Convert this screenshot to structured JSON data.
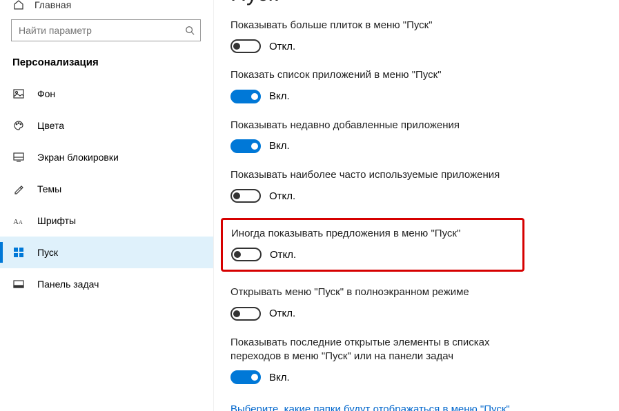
{
  "sidebar": {
    "home": "Главная",
    "search_placeholder": "Найти параметр",
    "section": "Персонализация",
    "items": [
      {
        "label": "Фон"
      },
      {
        "label": "Цвета"
      },
      {
        "label": "Экран блокировки"
      },
      {
        "label": "Темы"
      },
      {
        "label": "Шрифты"
      },
      {
        "label": "Пуск"
      },
      {
        "label": "Панель задач"
      }
    ]
  },
  "main": {
    "title": "Пуск",
    "state_on": "Вкл.",
    "state_off": "Откл.",
    "settings": [
      {
        "label": "Показывать больше плиток в меню \"Пуск\"",
        "on": false
      },
      {
        "label": "Показать список приложений в меню \"Пуск\"",
        "on": true
      },
      {
        "label": "Показывать недавно добавленные приложения",
        "on": true
      },
      {
        "label": "Показывать наиболее часто используемые приложения",
        "on": false
      },
      {
        "label": "Иногда показывать предложения в меню \"Пуск\"",
        "on": false,
        "highlighted": true
      },
      {
        "label": "Открывать меню \"Пуск\" в полноэкранном режиме",
        "on": false
      },
      {
        "label": "Показывать последние открытые элементы в списках переходов в меню \"Пуск\" или на панели задач",
        "on": true
      }
    ],
    "link": "Выберите, какие папки будут отображаться в меню \"Пуск\""
  }
}
